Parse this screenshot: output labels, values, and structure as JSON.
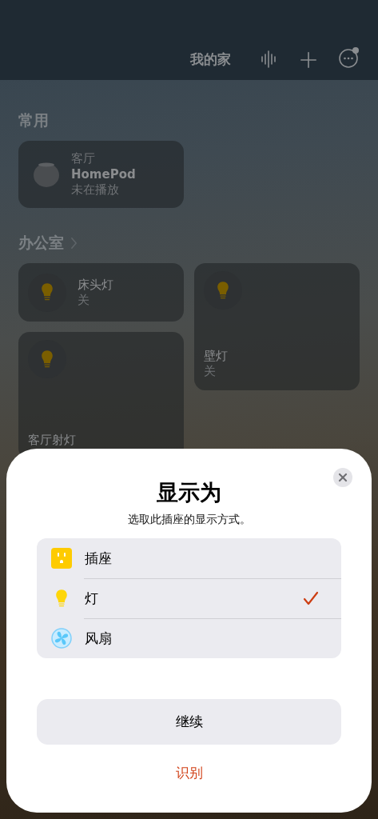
{
  "header": {
    "title": "我的家"
  },
  "sections": [
    {
      "title": "常用",
      "chevron": false,
      "tiles": [
        {
          "kind": "speaker",
          "room": "客厅",
          "name": "HomePod",
          "status": "未在播放"
        }
      ]
    },
    {
      "title": "办公室",
      "chevron": true,
      "tiles": [
        {
          "kind": "small",
          "name": "床头灯",
          "status": "关"
        },
        {
          "kind": "tall",
          "name": "壁灯",
          "status": "关"
        },
        {
          "kind": "tall",
          "name": "客厅射灯"
        }
      ]
    }
  ],
  "sheet": {
    "title": "显示为",
    "subtitle": "选取此插座的显示方式。",
    "options": [
      {
        "kind": "outlet",
        "label": "插座",
        "selected": false
      },
      {
        "kind": "bulb",
        "label": "灯",
        "selected": true
      },
      {
        "kind": "fan",
        "label": "风扇",
        "selected": false
      }
    ],
    "primary_button": "继续",
    "secondary_button": "识别"
  }
}
